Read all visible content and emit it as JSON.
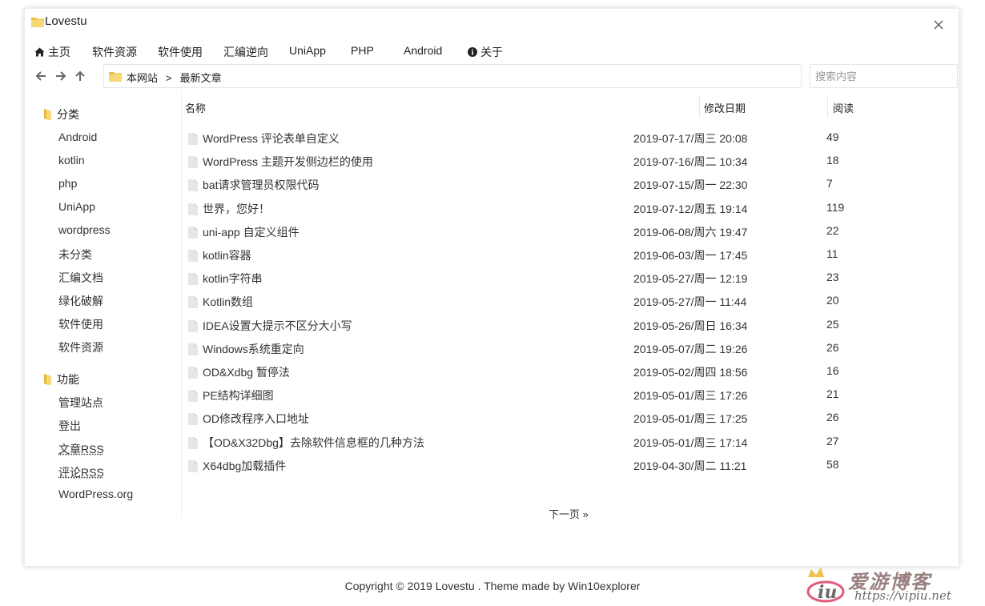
{
  "window": {
    "title": "Lovestu"
  },
  "menu": [
    {
      "label": "主页",
      "icon": "home-icon"
    },
    {
      "label": "软件资源"
    },
    {
      "label": "软件使用"
    },
    {
      "label": "汇编逆向"
    },
    {
      "label": "UniApp"
    },
    {
      "label": "PHP"
    },
    {
      "label": "Android"
    },
    {
      "label": "关于",
      "icon": "info-icon"
    }
  ],
  "address": {
    "root": "本网站",
    "separator": ">",
    "current": "最新文章"
  },
  "search": {
    "placeholder": "搜索内容",
    "value": ""
  },
  "sidebar": {
    "groups": [
      {
        "title": "分类",
        "items": [
          "Android",
          "kotlin",
          "php",
          "UniApp",
          "wordpress",
          "未分类",
          "汇编文档",
          "绿化破解",
          "软件使用",
          "软件资源"
        ]
      },
      {
        "title": "功能",
        "items": [
          "管理站点",
          "登出",
          "文章RSS",
          "评论RSS",
          "WordPress.org"
        ]
      }
    ]
  },
  "table": {
    "headers": {
      "name": "名称",
      "date": "修改日期",
      "reads": "阅读"
    },
    "rows": [
      {
        "name": "WordPress 评论表单自定义",
        "date": "2019-07-17/周三 20:08",
        "reads": "49"
      },
      {
        "name": "WordPress 主题开发侧边栏的使用",
        "date": "2019-07-16/周二 10:34",
        "reads": "18"
      },
      {
        "name": "bat请求管理员权限代码",
        "date": "2019-07-15/周一 22:30",
        "reads": "7"
      },
      {
        "name": "世界，您好！",
        "date": "2019-07-12/周五 19:14",
        "reads": "119"
      },
      {
        "name": "uni-app 自定义组件",
        "date": "2019-06-08/周六 19:47",
        "reads": "22"
      },
      {
        "name": "kotlin容器",
        "date": "2019-06-03/周一 17:45",
        "reads": "11"
      },
      {
        "name": "kotlin字符串",
        "date": "2019-05-27/周一 12:19",
        "reads": "23"
      },
      {
        "name": "Kotlin数组",
        "date": "2019-05-27/周一 11:44",
        "reads": "20"
      },
      {
        "name": "IDEA设置大提示不区分大小写",
        "date": "2019-05-26/周日 16:34",
        "reads": "25"
      },
      {
        "name": "Windows系统重定向",
        "date": "2019-05-07/周二 19:26",
        "reads": "26"
      },
      {
        "name": "OD&Xdbg 暂停法",
        "date": "2019-05-02/周四 18:56",
        "reads": "16"
      },
      {
        "name": "PE结构详细图",
        "date": "2019-05-01/周三 17:26",
        "reads": "21"
      },
      {
        "name": "OD修改程序入口地址",
        "date": "2019-05-01/周三 17:25",
        "reads": "26"
      },
      {
        "name": "【OD&X32Dbg】去除软件信息框的几种方法",
        "date": "2019-05-01/周三 17:14",
        "reads": "27"
      },
      {
        "name": "X64dbg加载插件",
        "date": "2019-04-30/周二 11:21",
        "reads": "58"
      }
    ]
  },
  "pagination": {
    "next": "下一页 »"
  },
  "footer": {
    "prefix": "Copyright © 2019",
    "site": "Lovestu",
    "middle": ". Theme made by",
    "theme": "Win10explorer"
  },
  "watermark": {
    "text": "爱游博客",
    "url": "https://vipiu.net"
  },
  "colors": {
    "folder": "#f8d775",
    "folder_dark": "#e8b93c",
    "file": "#e6e6e6"
  }
}
